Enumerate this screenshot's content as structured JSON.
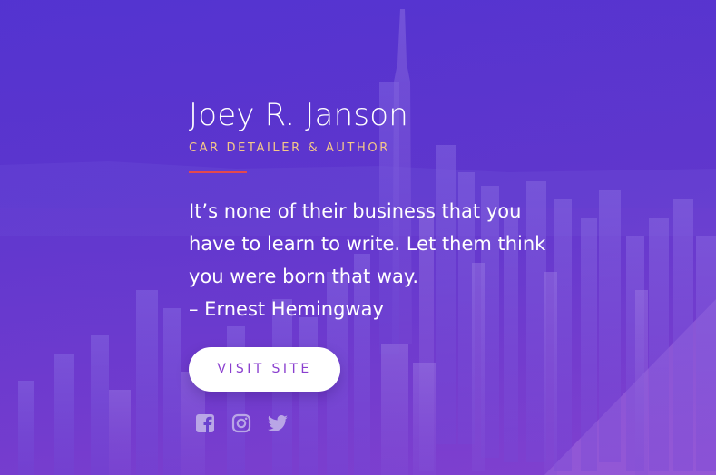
{
  "profile": {
    "name": "Joey R. Janson",
    "tagline": "CAR DETAILER & AUTHOR"
  },
  "quote": {
    "lines": [
      "It’s none of their business that you",
      "have to learn to write. Let them think",
      "you were born that way.",
      "– Ernest Hemingway"
    ]
  },
  "cta": {
    "label": "VISIT SITE"
  },
  "socials": [
    {
      "icon": "facebook-icon"
    },
    {
      "icon": "instagram-icon"
    },
    {
      "icon": "twitter-icon"
    }
  ],
  "colors": {
    "background_top": "#5535cf",
    "background_bottom": "#7a3ccc",
    "tagline": "#f4c889",
    "divider": "#e4494d",
    "button_bg": "#ffffff",
    "button_text": "#8a3fcf",
    "icon": "#b9a6e6"
  }
}
